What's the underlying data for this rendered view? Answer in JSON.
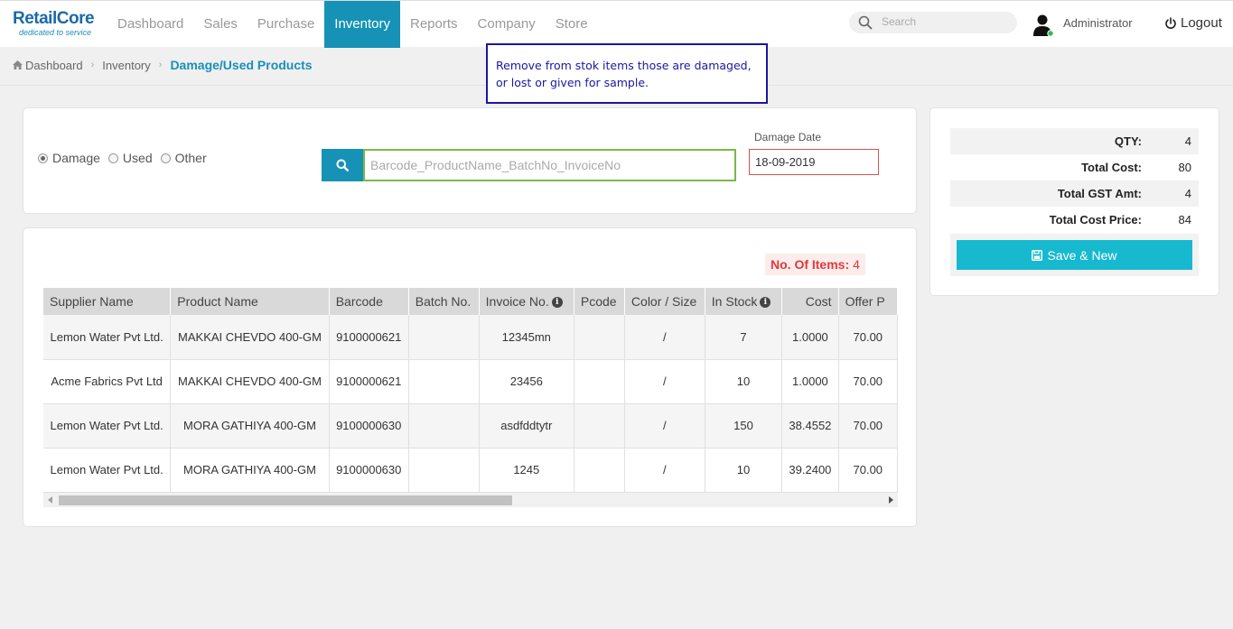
{
  "brand": {
    "name": "RetailCore",
    "tagline": "dedicated to service"
  },
  "nav": {
    "items": [
      "Dashboard",
      "Sales",
      "Purchase",
      "Inventory",
      "Reports",
      "Company",
      "Store"
    ],
    "active": "Inventory"
  },
  "search": {
    "placeholder": "Search"
  },
  "user": {
    "name": "Administrator",
    "logout": "Logout"
  },
  "breadcrumb": {
    "home": "Dashboard",
    "section": "Inventory",
    "current": "Damage/Used Products"
  },
  "note": {
    "line1": "Remove from stok items those are damaged,",
    "line2": "or lost or given for sample."
  },
  "filter": {
    "radios": [
      {
        "label": "Damage",
        "checked": true
      },
      {
        "label": "Used",
        "checked": false
      },
      {
        "label": "Other",
        "checked": false
      }
    ],
    "barcode_placeholder": "Barcode_ProductName_BatchNo_InvoiceNo",
    "damage_date_label": "Damage Date",
    "damage_date_value": "18-09-2019"
  },
  "items": {
    "label": "No. Of Items:",
    "count": "4"
  },
  "table": {
    "columns": [
      "Supplier Name",
      "Product Name",
      "Barcode",
      "Batch No.",
      "Invoice No.",
      "Pcode",
      "Color / Size",
      "In Stock",
      "Cost",
      "Offer P"
    ],
    "rows": [
      [
        "Lemon Water Pvt Ltd.",
        "MAKKAI CHEVDO 400-GM",
        "9100000621",
        "",
        "12345mn",
        "",
        "/",
        "7",
        "1.0000",
        "70.00"
      ],
      [
        "Acme Fabrics Pvt Ltd",
        "MAKKAI CHEVDO 400-GM",
        "9100000621",
        "",
        "23456",
        "",
        "/",
        "10",
        "1.0000",
        "70.00"
      ],
      [
        "Lemon Water Pvt Ltd.",
        "MORA GATHIYA 400-GM",
        "9100000630",
        "",
        "asdfddtytr",
        "",
        "/",
        "150",
        "38.4552",
        "70.00"
      ],
      [
        "Lemon Water Pvt Ltd.",
        "MORA GATHIYA 400-GM",
        "9100000630",
        "",
        "1245",
        "",
        "/",
        "10",
        "39.2400",
        "70.00"
      ]
    ]
  },
  "summary": {
    "qty_label": "QTY:",
    "qty": "4",
    "total_cost_label": "Total Cost:",
    "total_cost": "80",
    "gst_label": "Total GST Amt:",
    "gst": "4",
    "cost_price_label": "Total Cost Price:",
    "cost_price": "84",
    "save_label": "Save & New"
  },
  "colors": {
    "primary": "#1592b5",
    "save": "#17b9cf",
    "note_border": "#1a17a3",
    "danger": "#e03a3a"
  }
}
